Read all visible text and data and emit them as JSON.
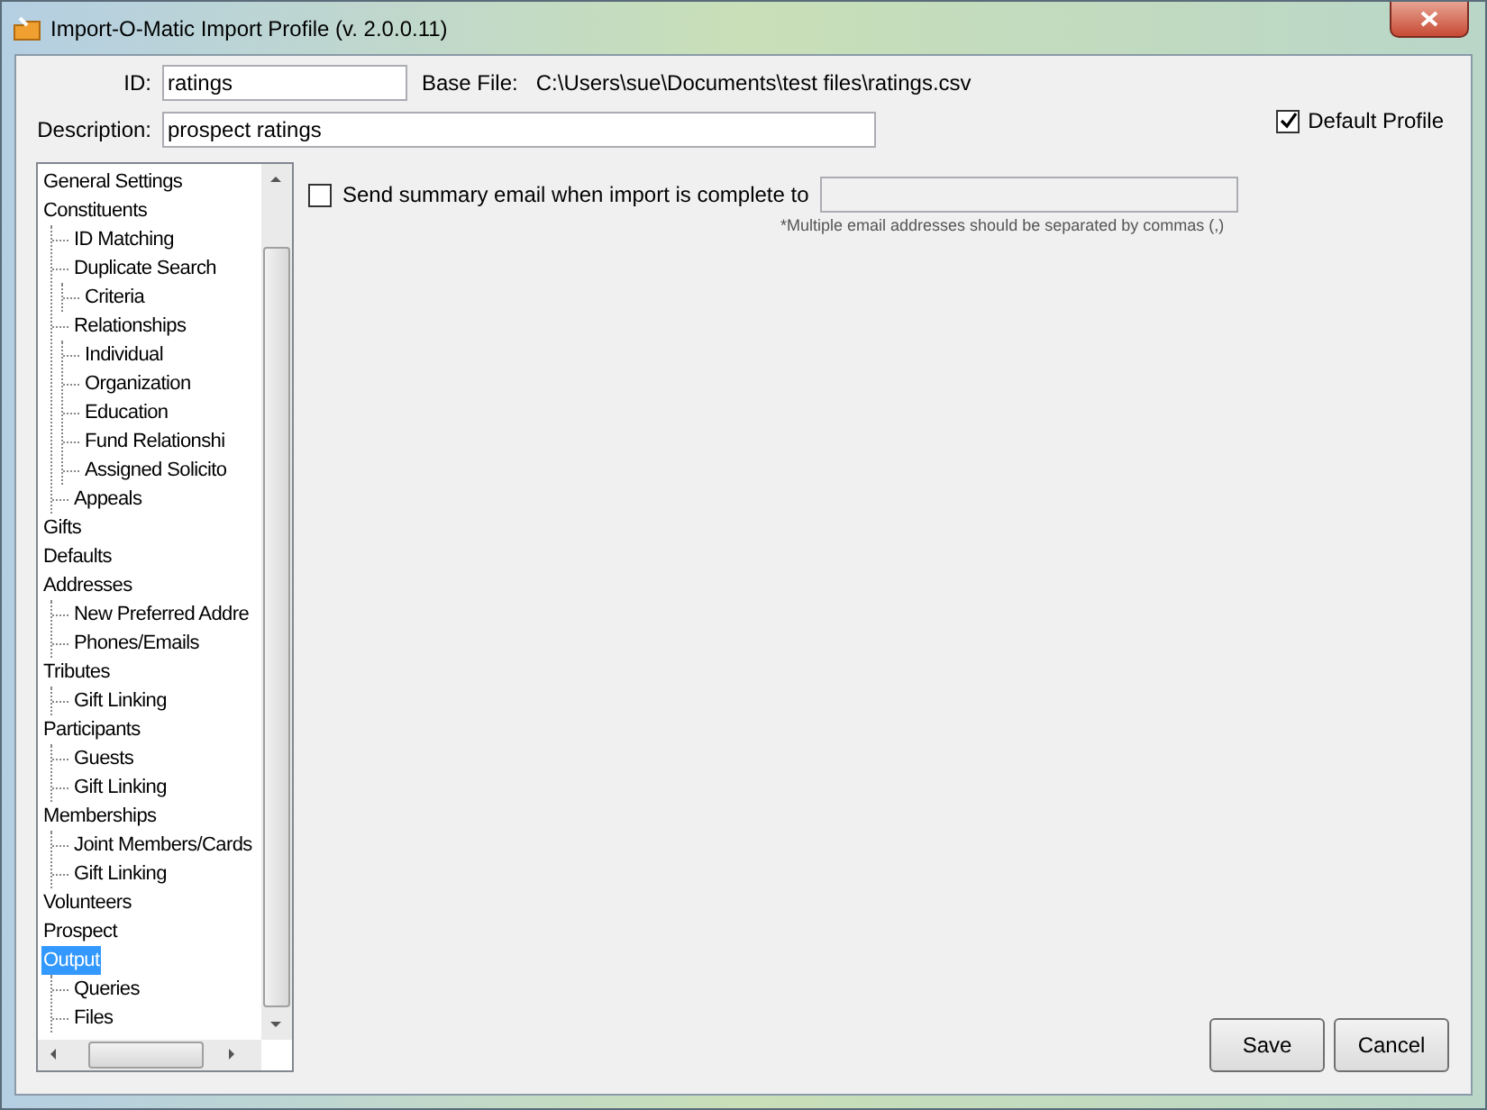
{
  "window": {
    "title": "Import-O-Matic Import Profile (v. 2.0.0.11)"
  },
  "id": {
    "label": "ID:",
    "value": "ratings"
  },
  "base_file": {
    "label": "Base File:",
    "value": "C:\\Users\\sue\\Documents\\test files\\ratings.csv"
  },
  "description": {
    "label": "Description:",
    "value": "prospect ratings"
  },
  "default_profile": {
    "label": "Default Profile",
    "checked": true
  },
  "tree": [
    {
      "label": "General Settings",
      "selected": false
    },
    {
      "label": "Constituents",
      "selected": false,
      "children": [
        {
          "label": "ID Matching",
          "selected": false
        },
        {
          "label": "Duplicate Search",
          "selected": false,
          "children": [
            {
              "label": "Criteria",
              "selected": false
            }
          ]
        },
        {
          "label": "Relationships",
          "selected": false,
          "children": [
            {
              "label": "Individual",
              "selected": false
            },
            {
              "label": "Organization",
              "selected": false
            },
            {
              "label": "Education",
              "selected": false
            },
            {
              "label": "Fund Relationshi",
              "selected": false
            },
            {
              "label": "Assigned Solicito",
              "selected": false
            }
          ]
        },
        {
          "label": "Appeals",
          "selected": false
        }
      ]
    },
    {
      "label": "Gifts",
      "selected": false
    },
    {
      "label": "Defaults",
      "selected": false
    },
    {
      "label": "Addresses",
      "selected": false,
      "children": [
        {
          "label": "New Preferred Addre",
          "selected": false
        },
        {
          "label": "Phones/Emails",
          "selected": false
        }
      ]
    },
    {
      "label": "Tributes",
      "selected": false,
      "children": [
        {
          "label": "Gift Linking",
          "selected": false
        }
      ]
    },
    {
      "label": "Participants",
      "selected": false,
      "children": [
        {
          "label": "Guests",
          "selected": false
        },
        {
          "label": "Gift Linking",
          "selected": false
        }
      ]
    },
    {
      "label": "Memberships",
      "selected": false,
      "children": [
        {
          "label": "Joint Members/Cards",
          "selected": false
        },
        {
          "label": "Gift Linking",
          "selected": false
        }
      ]
    },
    {
      "label": "Volunteers",
      "selected": false
    },
    {
      "label": "Prospect",
      "selected": false
    },
    {
      "label": "Output",
      "selected": true,
      "children": [
        {
          "label": "Queries",
          "selected": false
        },
        {
          "label": "Files",
          "selected": false
        }
      ]
    }
  ],
  "summary_email": {
    "label": "Send summary email when import is complete to",
    "checked": false,
    "note": "*Multiple email addresses should be separated by commas (,)"
  },
  "buttons": [
    "Save",
    "Cancel"
  ]
}
